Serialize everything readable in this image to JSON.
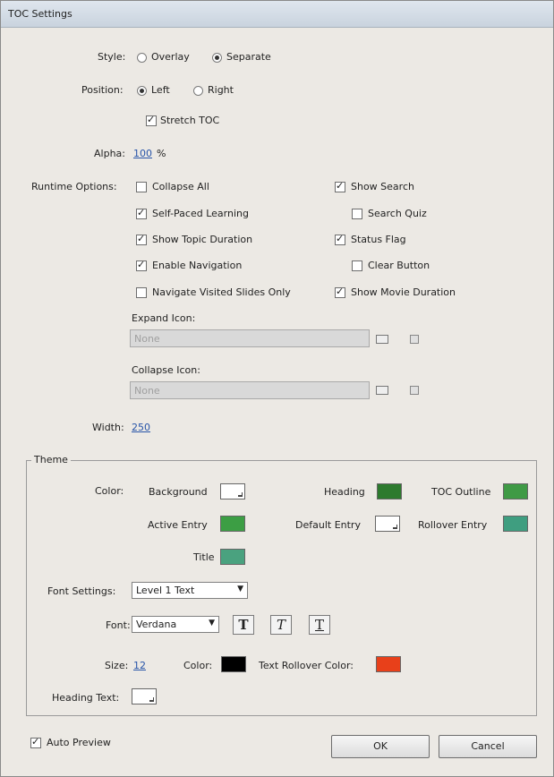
{
  "window": {
    "title": "TOC Settings"
  },
  "style": {
    "label": "Style:",
    "options": [
      "Overlay",
      "Separate"
    ],
    "selected": "Separate"
  },
  "position": {
    "label": "Position:",
    "options": [
      "Left",
      "Right"
    ],
    "selected": "Left"
  },
  "stretch_toc": {
    "label": "Stretch TOC",
    "checked": true
  },
  "alpha": {
    "label": "Alpha:",
    "value": "100",
    "unit": "%"
  },
  "runtime_options": {
    "label": "Runtime Options:",
    "items": [
      {
        "label": "Collapse All",
        "checked": false
      },
      {
        "label": "Self-Paced Learning",
        "checked": true
      },
      {
        "label": "Show Topic Duration",
        "checked": true
      },
      {
        "label": "Enable Navigation",
        "checked": true
      },
      {
        "label": "Navigate Visited Slides Only",
        "checked": false
      },
      {
        "label": "Show Search",
        "checked": true
      },
      {
        "label": "Search Quiz",
        "checked": false
      },
      {
        "label": "Status Flag",
        "checked": true
      },
      {
        "label": "Clear Button",
        "checked": false
      },
      {
        "label": "Show Movie Duration",
        "checked": true
      }
    ]
  },
  "expand_icon": {
    "label": "Expand Icon:",
    "value": "None"
  },
  "collapse_icon": {
    "label": "Collapse Icon:",
    "value": "None"
  },
  "width": {
    "label": "Width:",
    "value": "250"
  },
  "theme": {
    "title": "Theme",
    "color_label": "Color:",
    "background": "Background",
    "heading": "Heading",
    "toc_outline": "TOC Outline",
    "active_entry": "Active Entry",
    "default_entry": "Default Entry",
    "rollover_entry": "Rollover Entry",
    "title_label": "Title",
    "font_settings_label": "Font Settings:",
    "font_settings_value": "Level 1 Text",
    "font_label": "Font:",
    "font_value": "Verdana",
    "bold_glyph": "T",
    "italic_glyph": "T",
    "underline_glyph": "T",
    "size_label": "Size:",
    "size_value": "12",
    "color2_label": "Color:",
    "text_rollover_label": "Text Rollover Color:",
    "heading_text_label": "Heading Text:",
    "colors": {
      "heading": "#2d7a2e",
      "toc_outline": "#3f9a45",
      "active_entry": "#3c9e44",
      "rollover_entry": "#3f9e80",
      "title": "#4aa27f",
      "font_color": "#000000",
      "text_rollover": "#e8401a"
    }
  },
  "auto_preview": {
    "label": "Auto Preview",
    "checked": true
  },
  "buttons": {
    "ok": "OK",
    "cancel": "Cancel"
  }
}
